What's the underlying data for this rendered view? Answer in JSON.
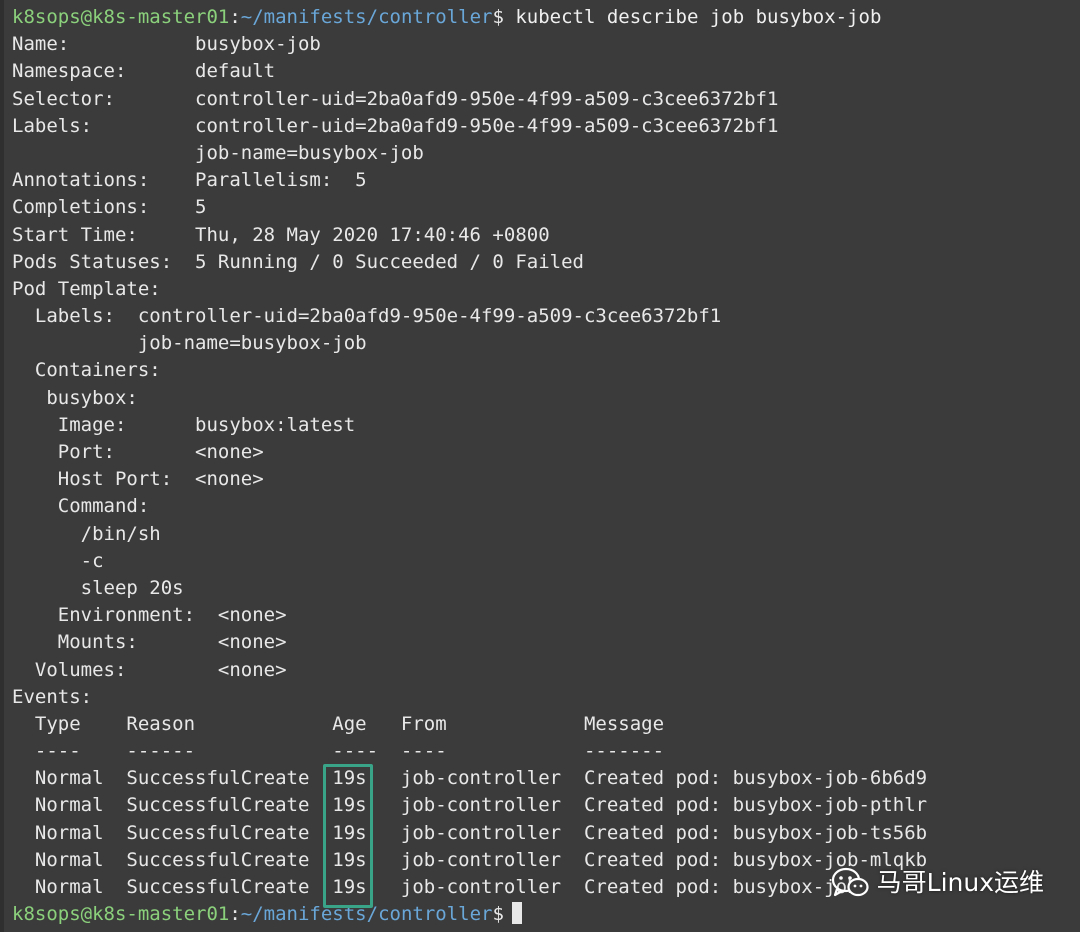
{
  "prompt": {
    "user_host": "k8sops@k8s-master01",
    "separator": ":",
    "path": "~/manifests/controller",
    "dollar": "$"
  },
  "command": " kubectl describe job busybox-job",
  "output_lines": [
    "Name:           busybox-job",
    "Namespace:      default",
    "Selector:       controller-uid=2ba0afd9-950e-4f99-a509-c3cee6372bf1",
    "Labels:         controller-uid=2ba0afd9-950e-4f99-a509-c3cee6372bf1",
    "                job-name=busybox-job",
    "Annotations:    Parallelism:  5",
    "Completions:    5",
    "Start Time:     Thu, 28 May 2020 17:40:46 +0800",
    "Pods Statuses:  5 Running / 0 Succeeded / 0 Failed",
    "Pod Template:",
    "  Labels:  controller-uid=2ba0afd9-950e-4f99-a509-c3cee6372bf1",
    "           job-name=busybox-job",
    "  Containers:",
    "   busybox:",
    "    Image:      busybox:latest",
    "    Port:       <none>",
    "    Host Port:  <none>",
    "    Command:",
    "      /bin/sh",
    "      -c",
    "      sleep 20s",
    "    Environment:  <none>",
    "    Mounts:       <none>",
    "  Volumes:        <none>",
    "Events:",
    "  Type    Reason            Age   From            Message",
    "  ----    ------            ----  ----            -------",
    "  Normal  SuccessfulCreate  19s   job-controller  Created pod: busybox-job-6b6d9",
    "  Normal  SuccessfulCreate  19s   job-controller  Created pod: busybox-job-pthlr",
    "  Normal  SuccessfulCreate  19s   job-controller  Created pod: busybox-job-ts56b",
    "  Normal  SuccessfulCreate  19s   job-controller  Created pod: busybox-job-mlqkb",
    "  Normal  SuccessfulCreate  19s   job-controller  Created pod: busybox-job-"
  ],
  "watermark": {
    "text": "马哥Linux运维",
    "icon": "wechat-icon"
  },
  "colors": {
    "background": "#3b3b3b",
    "text": "#e8e8e8",
    "prompt_user": "#8bd17c",
    "prompt_path": "#6aa7d9",
    "highlight_box": "#3aa489"
  }
}
